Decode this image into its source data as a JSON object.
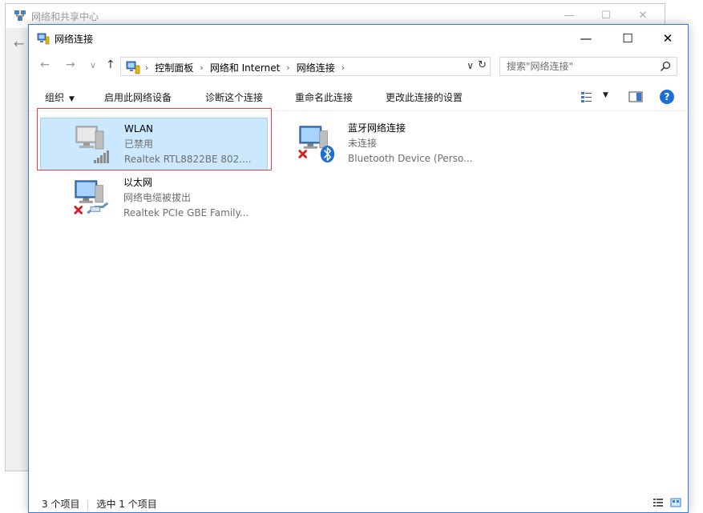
{
  "background_window": {
    "title": "网络和共享中心",
    "back_glyph": "←",
    "minimize_glyph": "—",
    "maximize_glyph": "☐",
    "close_glyph": "✕"
  },
  "window": {
    "title": "网络连接",
    "minimize_glyph": "—",
    "maximize_glyph": "☐",
    "close_glyph": "✕"
  },
  "nav": {
    "back_glyph": "←",
    "forward_glyph": "→",
    "recent_glyph": "∨",
    "up_glyph": "↑"
  },
  "address": {
    "breadcrumbs": [
      "控制面板",
      "网络和 Internet",
      "网络连接"
    ],
    "separator": "›",
    "dropdown_glyph": "∨",
    "refresh_glyph": "↻"
  },
  "search": {
    "placeholder": "搜索\"网络连接\""
  },
  "command_bar": {
    "organize": "组织",
    "organize_arrow": "▼",
    "enable": "启用此网络设备",
    "diagnose": "诊断这个连接",
    "rename": "重命名此连接",
    "change_settings": "更改此连接的设置",
    "view_arrow": "▼",
    "help": "?"
  },
  "connections": [
    {
      "name": "WLAN",
      "status": "已禁用",
      "device": "Realtek RTL8822BE 802....",
      "icon": "wifi-adapter-icon",
      "selected": true
    },
    {
      "name": "蓝牙网络连接",
      "status": "未连接",
      "device": "Bluetooth Device (Perso...",
      "icon": "bluetooth-adapter-icon",
      "selected": false
    },
    {
      "name": "以太网",
      "status": "网络电缆被拔出",
      "device": "Realtek PCIe GBE Family...",
      "icon": "ethernet-adapter-icon",
      "selected": false
    }
  ],
  "status_bar": {
    "item_count": "3 个项目",
    "selected_count": "选中 1 个项目"
  },
  "colors": {
    "selection_bg": "#cce8ff",
    "selection_border": "#99d1ff",
    "highlight_red": "#e0464a",
    "accent_blue": "#1c6ed6"
  }
}
